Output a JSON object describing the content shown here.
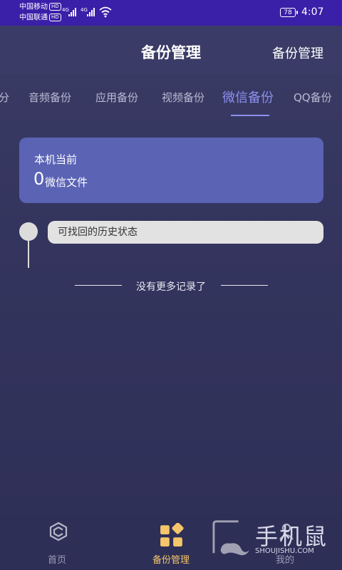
{
  "status_bar": {
    "carrier1": "中国移动",
    "carrier2": "中国联通",
    "hd": "HD",
    "net1": "4G",
    "net2": "4G",
    "battery": "78",
    "time": "4:07"
  },
  "header": {
    "title": "备份管理",
    "action": "备份管理"
  },
  "tabs": [
    {
      "label": "分",
      "active": false
    },
    {
      "label": "音频备份",
      "active": false
    },
    {
      "label": "应用备份",
      "active": false
    },
    {
      "label": "视频备份",
      "active": false
    },
    {
      "label": "微信备份",
      "active": true
    },
    {
      "label": "QQ备份",
      "active": false
    }
  ],
  "card": {
    "title": "本机当前",
    "count": "0",
    "unit": "微信文件"
  },
  "history": {
    "label": "可找回的历史状态"
  },
  "no_more": "没有更多记录了",
  "bottom_nav": [
    {
      "label": "首页",
      "icon": "home-icon",
      "active": false
    },
    {
      "label": "备份管理",
      "icon": "backup-grid-icon",
      "active": true
    },
    {
      "label": "我的",
      "icon": "profile-icon",
      "active": false
    }
  ],
  "watermark": {
    "title": "手机鼠",
    "url": "SHOUJISHU.COM"
  },
  "colors": {
    "status_bar": "#3a1fa8",
    "accent": "#8c90ee",
    "card": "#5a63b4",
    "nav_active": "#f4c56a"
  }
}
